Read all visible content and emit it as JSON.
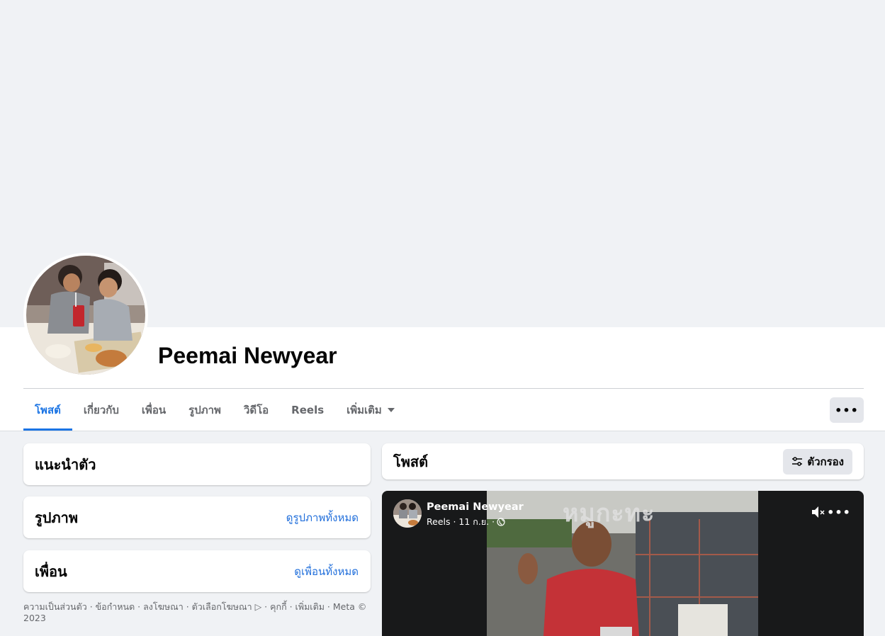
{
  "profile": {
    "name": "Peemai Newyear"
  },
  "tabs": [
    {
      "label": "โพสต์",
      "active": true
    },
    {
      "label": "เกี่ยวกับ",
      "active": false
    },
    {
      "label": "เพื่อน",
      "active": false
    },
    {
      "label": "รูปภาพ",
      "active": false
    },
    {
      "label": "วิดีโอ",
      "active": false
    },
    {
      "label": "Reels",
      "active": false
    },
    {
      "label": "เพิ่มเติม",
      "active": false,
      "has_dropdown": true
    }
  ],
  "more_button": {
    "label": "•••"
  },
  "intro_card": {
    "title": "แนะนำตัว"
  },
  "photos_card": {
    "title": "รูปภาพ",
    "link": "ดูรูปภาพทั้งหมด"
  },
  "friends_card": {
    "title": "เพื่อน",
    "link": "ดูเพื่อนทั้งหมด"
  },
  "footer": {
    "text": "ความเป็นส่วนตัว · ข้อกำหนด · ลงโฆษณา · ตัวเลือกโฆษณา ▷ · คุกกี้ · เพิ่มเติม · Meta © 2023"
  },
  "posts_card": {
    "title": "โพสต์",
    "filter_label": "ตัวกรอง"
  },
  "reel_post": {
    "author": "Peemai Newyear",
    "meta": "Reels · 11 ก.ย. ·",
    "overlay_text": "หมูกะทะ",
    "more_label": "•••",
    "privacy_icon": "globe-icon",
    "mute_icon": "speaker-muted-icon"
  },
  "colors": {
    "accent": "#1b74e4",
    "link": "#216fdb",
    "page_bg": "#f0f2f5",
    "button_bg": "#e4e6eb"
  }
}
